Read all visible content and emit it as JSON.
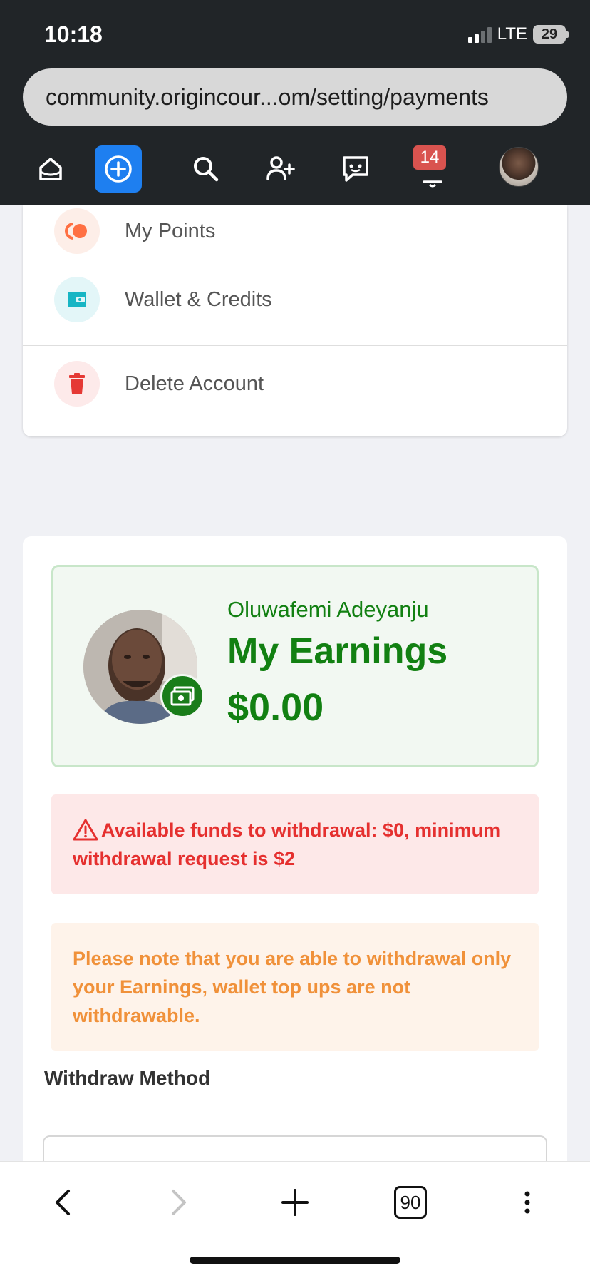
{
  "status_bar": {
    "time": "10:18",
    "network": "LTE",
    "battery": "29"
  },
  "browser": {
    "url": "community.origincour...om/setting/payments",
    "tabs_count": "90"
  },
  "app_nav": {
    "notification_count": "14"
  },
  "menu": {
    "items": [
      {
        "label": "My Points",
        "icon": "points-icon",
        "color": "#ff7043"
      },
      {
        "label": "Wallet & Credits",
        "icon": "wallet-icon",
        "color": "#17b5c4"
      },
      {
        "label": "Delete Account",
        "icon": "trash-icon",
        "color": "#e53935"
      }
    ]
  },
  "earnings": {
    "name": "Oluwafemi Adeyanju",
    "title": "My Earnings",
    "amount": "$0.00",
    "brand_color": "#128012"
  },
  "alerts": {
    "funds": "Available funds to withdrawal: $0, minimum withdrawal request is $2",
    "note": "Please note that you are able to withdrawal only your Earnings, wallet top ups are not withdrawable."
  },
  "withdraw": {
    "label": "Withdraw Method",
    "value": ""
  }
}
